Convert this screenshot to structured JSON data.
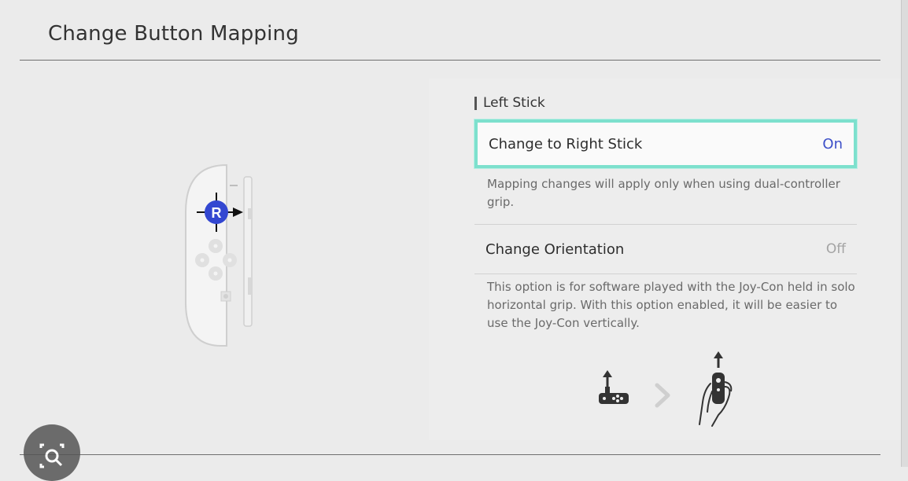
{
  "header": {
    "title": "Change Button Mapping"
  },
  "section": {
    "title": "Left Stick"
  },
  "settings": [
    {
      "label": "Change to Right Stick",
      "value": "On",
      "description": "Mapping changes will apply only when using dual-controller grip."
    },
    {
      "label": "Change Orientation",
      "value": "Off",
      "description": "This option is for software played with the Joy-Con held in solo horizontal grip. With this option enabled, it will be easier to use the Joy-Con vertically."
    }
  ],
  "joycon": {
    "button_letter": "R"
  },
  "icons": {
    "joycon": "left-joycon-diagram-icon",
    "stick_arrow": "arrow-right-icon",
    "horizontal": "joycon-horizontal-icon",
    "chevron": "chevron-right-icon",
    "vertical": "hand-holding-joycon-icon",
    "capture": "camera-search-icon"
  },
  "colors": {
    "accent_highlight": "#7de0cd",
    "on_value": "#3c4fc8",
    "stick_marker": "#3347d1"
  }
}
